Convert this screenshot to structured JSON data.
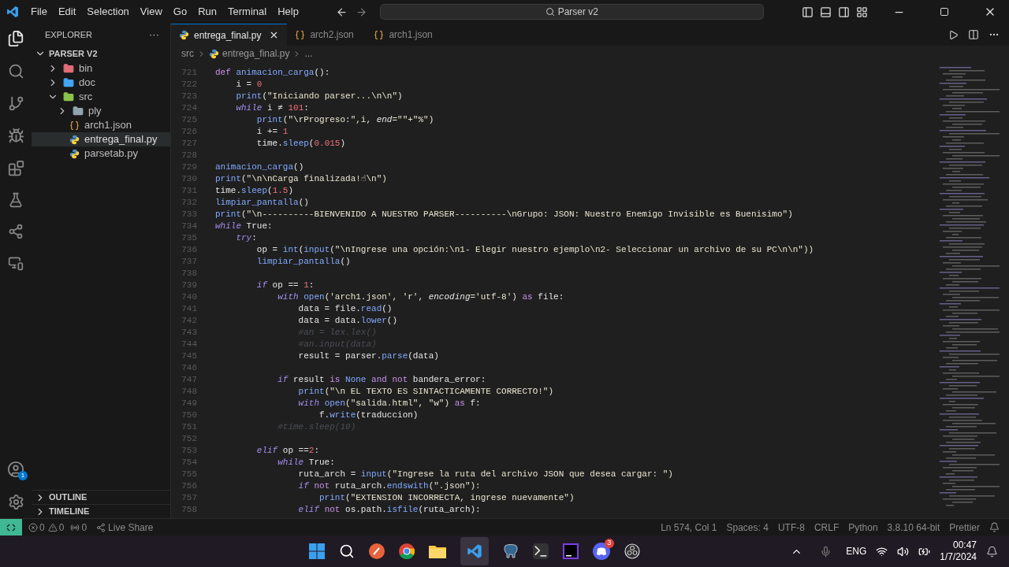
{
  "menu": [
    "File",
    "Edit",
    "Selection",
    "View",
    "Go",
    "Run",
    "Terminal",
    "Help"
  ],
  "search": {
    "value": "Parser v2"
  },
  "sidebar": {
    "title": "EXPLORER",
    "more": "···",
    "root": {
      "label": "PARSER V2",
      "expanded": true,
      "children": [
        {
          "label": "bin",
          "kind": "folder",
          "color": "#e06c75",
          "expanded": false,
          "selected": false
        },
        {
          "label": "doc",
          "kind": "folder",
          "color": "#42a5f5",
          "expanded": false,
          "selected": false
        },
        {
          "label": "src",
          "kind": "folder",
          "color": "#8bc34a",
          "expanded": true,
          "selected": false,
          "children": [
            {
              "label": "ply",
              "kind": "folder",
              "color": "#90a4ae",
              "expanded": false,
              "selected": false
            },
            {
              "label": "arch1.json",
              "kind": "json",
              "selected": false
            },
            {
              "label": "entrega_final.py",
              "kind": "python",
              "selected": true
            },
            {
              "label": "parsetab.py",
              "kind": "python",
              "selected": false
            }
          ]
        }
      ]
    },
    "sections": [
      {
        "label": "OUTLINE",
        "expanded": false
      },
      {
        "label": "TIMELINE",
        "expanded": false
      }
    ]
  },
  "tabs": [
    {
      "label": "entrega_final.py",
      "kind": "python",
      "selected": true
    },
    {
      "label": "arch2.json",
      "kind": "json",
      "selected": false
    },
    {
      "label": "arch1.json",
      "kind": "json",
      "selected": false
    }
  ],
  "breadcrumbs": [
    "src",
    "entrega_final.py",
    "..."
  ],
  "code": [
    {
      "number": "721",
      "tokens": [
        {
          "t": "def ",
          "kind": "kw"
        },
        {
          "t": "animacion_carga",
          "kind": "fn"
        },
        {
          "t": "():",
          "kind": "p"
        }
      ]
    },
    {
      "number": "722",
      "tokens": [
        {
          "t": "    i = ",
          "kind": "p"
        },
        {
          "t": "0",
          "kind": "num"
        }
      ]
    },
    {
      "number": "723",
      "tokens": [
        {
          "t": "    print",
          "kind": "fn"
        },
        {
          "t": "(\"Iniciando parser...\\n\\n\")",
          "kind": "str"
        }
      ]
    },
    {
      "number": "724",
      "tokens": [
        {
          "t": "    while",
          "kind": "ctl"
        },
        {
          "t": " i ≠ ",
          "kind": "p"
        },
        {
          "t": "101",
          "kind": "num"
        },
        {
          "t": ":",
          "kind": "p"
        }
      ]
    },
    {
      "number": "725",
      "tokens": [
        {
          "t": "        print",
          "kind": "fn"
        },
        {
          "t": "(\"\\rProgreso:\",i, ",
          "kind": "str"
        },
        {
          "t": "end",
          "kind": "param"
        },
        {
          "t": "=\"\"+\"%\")",
          "kind": "str"
        }
      ]
    },
    {
      "number": "726",
      "tokens": [
        {
          "t": "        i += ",
          "kind": "p"
        },
        {
          "t": "1",
          "kind": "num"
        }
      ]
    },
    {
      "number": "727",
      "tokens": [
        {
          "t": "        time.",
          "kind": "p"
        },
        {
          "t": "sleep",
          "kind": "fn"
        },
        {
          "t": "(",
          "kind": "p"
        },
        {
          "t": "0.015",
          "kind": "num"
        },
        {
          "t": ")",
          "kind": "p"
        }
      ]
    },
    {
      "number": "728"
    },
    {
      "number": "729",
      "tokens": [
        {
          "t": "animacion_carga",
          "kind": "fn"
        },
        {
          "t": "()",
          "kind": "p"
        }
      ]
    },
    {
      "number": "730",
      "tokens": [
        {
          "t": "print",
          "kind": "fn"
        },
        {
          "t": "(\"\\n\\nCarga finalizada!☝\\n\")",
          "kind": "str"
        }
      ]
    },
    {
      "number": "731",
      "tokens": [
        {
          "t": "time.",
          "kind": "p"
        },
        {
          "t": "sleep",
          "kind": "fn"
        },
        {
          "t": "(",
          "kind": "p"
        },
        {
          "t": "1.5",
          "kind": "num"
        },
        {
          "t": ")",
          "kind": "p"
        }
      ]
    },
    {
      "number": "732",
      "tokens": [
        {
          "t": "limpiar_pantalla",
          "kind": "fn"
        },
        {
          "t": "()",
          "kind": "p"
        }
      ]
    },
    {
      "number": "733",
      "tokens": [
        {
          "t": "print",
          "kind": "fn"
        },
        {
          "t": "(\"\\n----------BIENVENIDO A NUESTRO PARSER----------\\nGrupo: JSON: Nuestro Enemigo Invisible es Buenisimo\")",
          "kind": "str"
        }
      ]
    },
    {
      "number": "734",
      "tokens": [
        {
          "t": "while",
          "kind": "ctl"
        },
        {
          "t": " True:",
          "kind": "p"
        }
      ]
    },
    {
      "number": "735",
      "tokens": [
        {
          "t": "    try",
          "kind": "ctl"
        },
        {
          "t": ":",
          "kind": "p"
        }
      ]
    },
    {
      "number": "736",
      "tokens": [
        {
          "t": "        op = ",
          "kind": "p"
        },
        {
          "t": "int",
          "kind": "fn"
        },
        {
          "t": "(",
          "kind": "p"
        },
        {
          "t": "input",
          "kind": "fn"
        },
        {
          "t": "(\"\\nIngrese una opción:\\n1- Elegir nuestro ejemplo\\n2- Seleccionar un archivo de su PC\\n\\n\"))",
          "kind": "str"
        }
      ]
    },
    {
      "number": "737",
      "tokens": [
        {
          "t": "        limpiar_pantalla",
          "kind": "fn"
        },
        {
          "t": "()",
          "kind": "p"
        }
      ]
    },
    {
      "number": "738"
    },
    {
      "number": "739",
      "tokens": [
        {
          "t": "        if",
          "kind": "ctl"
        },
        {
          "t": " op == ",
          "kind": "p"
        },
        {
          "t": "1",
          "kind": "num"
        },
        {
          "t": ":",
          "kind": "p"
        }
      ]
    },
    {
      "number": "740",
      "tokens": [
        {
          "t": "            with",
          "kind": "ctl"
        },
        {
          "t": " open",
          "kind": "fn"
        },
        {
          "t": "('arch1.json', 'r', ",
          "kind": "str"
        },
        {
          "t": "encoding",
          "kind": "param"
        },
        {
          "t": "='utf-8') ",
          "kind": "str"
        },
        {
          "t": "as",
          "kind": "kw"
        },
        {
          "t": " file:",
          "kind": "p"
        }
      ]
    },
    {
      "number": "741",
      "tokens": [
        {
          "t": "                data = file.",
          "kind": "p"
        },
        {
          "t": "read",
          "kind": "fn"
        },
        {
          "t": "()",
          "kind": "p"
        }
      ]
    },
    {
      "number": "742",
      "tokens": [
        {
          "t": "                data = data.",
          "kind": "p"
        },
        {
          "t": "lower",
          "kind": "fn"
        },
        {
          "t": "()",
          "kind": "p"
        }
      ]
    },
    {
      "number": "743",
      "tokens": [
        {
          "t": "                #an = lex.lex()",
          "kind": "cm"
        }
      ]
    },
    {
      "number": "744",
      "tokens": [
        {
          "t": "                #an.input(data)",
          "kind": "cm"
        }
      ]
    },
    {
      "number": "745",
      "tokens": [
        {
          "t": "                result = parser.",
          "kind": "p"
        },
        {
          "t": "parse",
          "kind": "fn"
        },
        {
          "t": "(data)",
          "kind": "p"
        }
      ]
    },
    {
      "number": "746"
    },
    {
      "number": "747",
      "tokens": [
        {
          "t": "            if",
          "kind": "ctl"
        },
        {
          "t": " result ",
          "kind": "p"
        },
        {
          "t": "is",
          "kind": "kw"
        },
        {
          "t": " None ",
          "kind": "fn"
        },
        {
          "t": "and not",
          "kind": "kw"
        },
        {
          "t": " bandera_error:",
          "kind": "p"
        }
      ]
    },
    {
      "number": "748",
      "tokens": [
        {
          "t": "                print",
          "kind": "fn"
        },
        {
          "t": "(\"\\n EL TEXTO ES SINTACTICAMENTE CORRECTO!\")",
          "kind": "str"
        }
      ]
    },
    {
      "number": "749",
      "tokens": [
        {
          "t": "                with",
          "kind": "ctl"
        },
        {
          "t": " open",
          "kind": "fn"
        },
        {
          "t": "(\"salida.html\", \"w\") ",
          "kind": "str"
        },
        {
          "t": "as",
          "kind": "kw"
        },
        {
          "t": " f:",
          "kind": "p"
        }
      ]
    },
    {
      "number": "750",
      "tokens": [
        {
          "t": "                    f.",
          "kind": "p"
        },
        {
          "t": "write",
          "kind": "fn"
        },
        {
          "t": "(traduccion)",
          "kind": "p"
        }
      ]
    },
    {
      "number": "751",
      "tokens": [
        {
          "t": "            #time.sleep(10)",
          "kind": "cm"
        }
      ]
    },
    {
      "number": "752"
    },
    {
      "number": "753",
      "tokens": [
        {
          "t": "        elif",
          "kind": "ctl"
        },
        {
          "t": " op ==",
          "kind": "p"
        },
        {
          "t": "2",
          "kind": "num"
        },
        {
          "t": ":",
          "kind": "p"
        }
      ]
    },
    {
      "number": "754",
      "tokens": [
        {
          "t": "            while",
          "kind": "ctl"
        },
        {
          "t": " True:",
          "kind": "p"
        }
      ]
    },
    {
      "number": "755",
      "tokens": [
        {
          "t": "                ruta_arch = ",
          "kind": "p"
        },
        {
          "t": "input",
          "kind": "fn"
        },
        {
          "t": "(\"Ingrese la ruta del archivo JSON que desea cargar: \")",
          "kind": "str"
        }
      ]
    },
    {
      "number": "756",
      "tokens": [
        {
          "t": "                if",
          "kind": "ctl"
        },
        {
          "t": " not",
          "kind": "kw"
        },
        {
          "t": " ruta_arch.",
          "kind": "p"
        },
        {
          "t": "endswith",
          "kind": "fn"
        },
        {
          "t": "(\".json\"):",
          "kind": "str"
        }
      ]
    },
    {
      "number": "757",
      "tokens": [
        {
          "t": "                    print",
          "kind": "fn"
        },
        {
          "t": "(\"EXTENSION INCORRECTA, ingrese nuevamente\")",
          "kind": "str"
        }
      ]
    },
    {
      "number": "758",
      "tokens": [
        {
          "t": "                elif",
          "kind": "ctl"
        },
        {
          "t": " not",
          "kind": "kw"
        },
        {
          "t": " os.path.",
          "kind": "p"
        },
        {
          "t": "isfile",
          "kind": "fn"
        },
        {
          "t": "(ruta_arch):",
          "kind": "p"
        }
      ]
    }
  ],
  "accounts_badge": "1",
  "status_left": {
    "errors": "0",
    "warnings": "0",
    "ports": "0",
    "live_share": "Live Share"
  },
  "status_right": [
    "Ln 574, Col 1",
    "Spaces: 4",
    "UTF-8",
    "CRLF",
    "Python",
    "3.8.10 64-bit",
    "Prettier"
  ],
  "taskbar": {
    "language": "ENG",
    "time": "00:47",
    "date": "1/7/2024",
    "discord_badge": "3"
  }
}
